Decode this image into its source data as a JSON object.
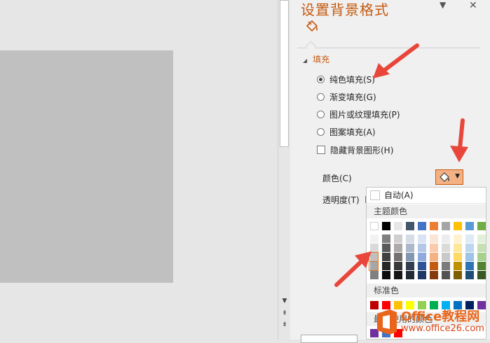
{
  "pane": {
    "title": "设置背景格式",
    "pin_icon": "dropdown-triangle",
    "close_label": "✕"
  },
  "fill": {
    "section_label": "填充",
    "options": [
      {
        "label": "纯色填充(S)",
        "selected": true
      },
      {
        "label": "渐变填充(G)",
        "selected": false
      },
      {
        "label": "图片或纹理填充(P)",
        "selected": false
      },
      {
        "label": "图案填充(A)",
        "selected": false
      }
    ],
    "hide_bg": {
      "label": "隐藏背景图形(H)",
      "checked": false
    },
    "color_label": "颜色(C)",
    "transparency_label": "透明度(T)"
  },
  "palette": {
    "auto_label": "自动(A)",
    "theme_header": "主题颜色",
    "standard_header": "标准色",
    "recent_header": "最近使用的颜色",
    "theme_base": [
      "#ffffff",
      "#000000",
      "#e7e6e6",
      "#44546a",
      "#4472c4",
      "#ed7d31",
      "#a5a5a5",
      "#ffc000",
      "#5b9bd5",
      "#70ad47"
    ],
    "theme_shades": [
      [
        "#f2f2f2",
        "#d9d9d9",
        "#bfbfbf",
        "#a6a6a6",
        "#808080"
      ],
      [
        "#7f7f7f",
        "#595959",
        "#404040",
        "#262626",
        "#0d0d0d"
      ],
      [
        "#d0cece",
        "#aeaaaa",
        "#757171",
        "#3a3838",
        "#171616"
      ],
      [
        "#d6dce5",
        "#adb9ca",
        "#8497b0",
        "#333f50",
        "#222a35"
      ],
      [
        "#dae3f3",
        "#b4c7e7",
        "#8faadc",
        "#2f5597",
        "#203864"
      ],
      [
        "#fbe5d6",
        "#f8cbad",
        "#f4b183",
        "#c55a11",
        "#843c0c"
      ],
      [
        "#ededed",
        "#dbdbdb",
        "#c9c9c9",
        "#7b7b7b",
        "#525252"
      ],
      [
        "#fff2cc",
        "#ffe699",
        "#ffd966",
        "#bf9000",
        "#7f6000"
      ],
      [
        "#deebf7",
        "#bdd7ee",
        "#9dc3e6",
        "#2e75b6",
        "#1f4e79"
      ],
      [
        "#e2f0d9",
        "#c5e0b4",
        "#a9d18e",
        "#548235",
        "#385723"
      ]
    ],
    "standard": [
      "#c00000",
      "#ff0000",
      "#ffc000",
      "#ffff00",
      "#92d050",
      "#00b050",
      "#00b0f0",
      "#0070c0",
      "#002060",
      "#7030a0"
    ],
    "recent": [
      "#7030a0",
      "#4472c4",
      "#ff0000"
    ],
    "selected_color": "#f4b183"
  },
  "watermark": {
    "line1": "Office教程网",
    "line2": "www.office26.com"
  },
  "colors": {
    "accent": "#c55a11",
    "arrow": "#e8463a"
  }
}
